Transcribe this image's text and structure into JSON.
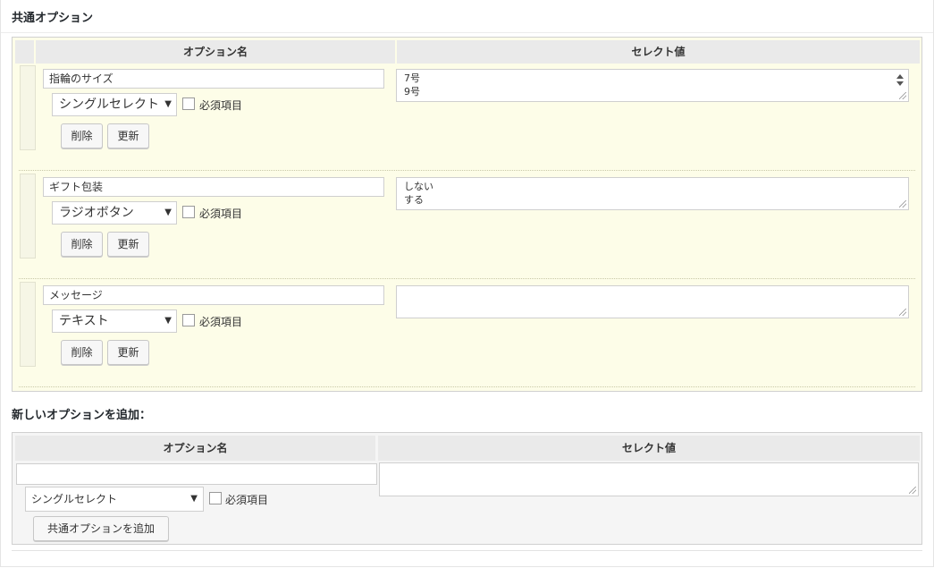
{
  "section": {
    "title": "共通オプション"
  },
  "table": {
    "col_name": "オプション名",
    "col_value": "セレクト値",
    "rows": [
      {
        "name": "指輪のサイズ",
        "type": "シングルセレクト",
        "required_label": "必須項目",
        "values": "7号\n9号",
        "delete_label": "削除",
        "update_label": "更新"
      },
      {
        "name": "ギフト包装",
        "type": "ラジオボタン",
        "required_label": "必須項目",
        "values": "しない\nする",
        "delete_label": "削除",
        "update_label": "更新"
      },
      {
        "name": "メッセージ",
        "type": "テキスト",
        "required_label": "必須項目",
        "values": "",
        "delete_label": "削除",
        "update_label": "更新"
      }
    ]
  },
  "add": {
    "title": "新しいオプションを追加：",
    "col_name": "オプション名",
    "col_value": "セレクト値",
    "name_value": "",
    "type": "シングルセレクト",
    "required_label": "必須項目",
    "values": "",
    "button_label": "共通オプションを追加"
  },
  "icons": {
    "select_arrow": "▼"
  }
}
